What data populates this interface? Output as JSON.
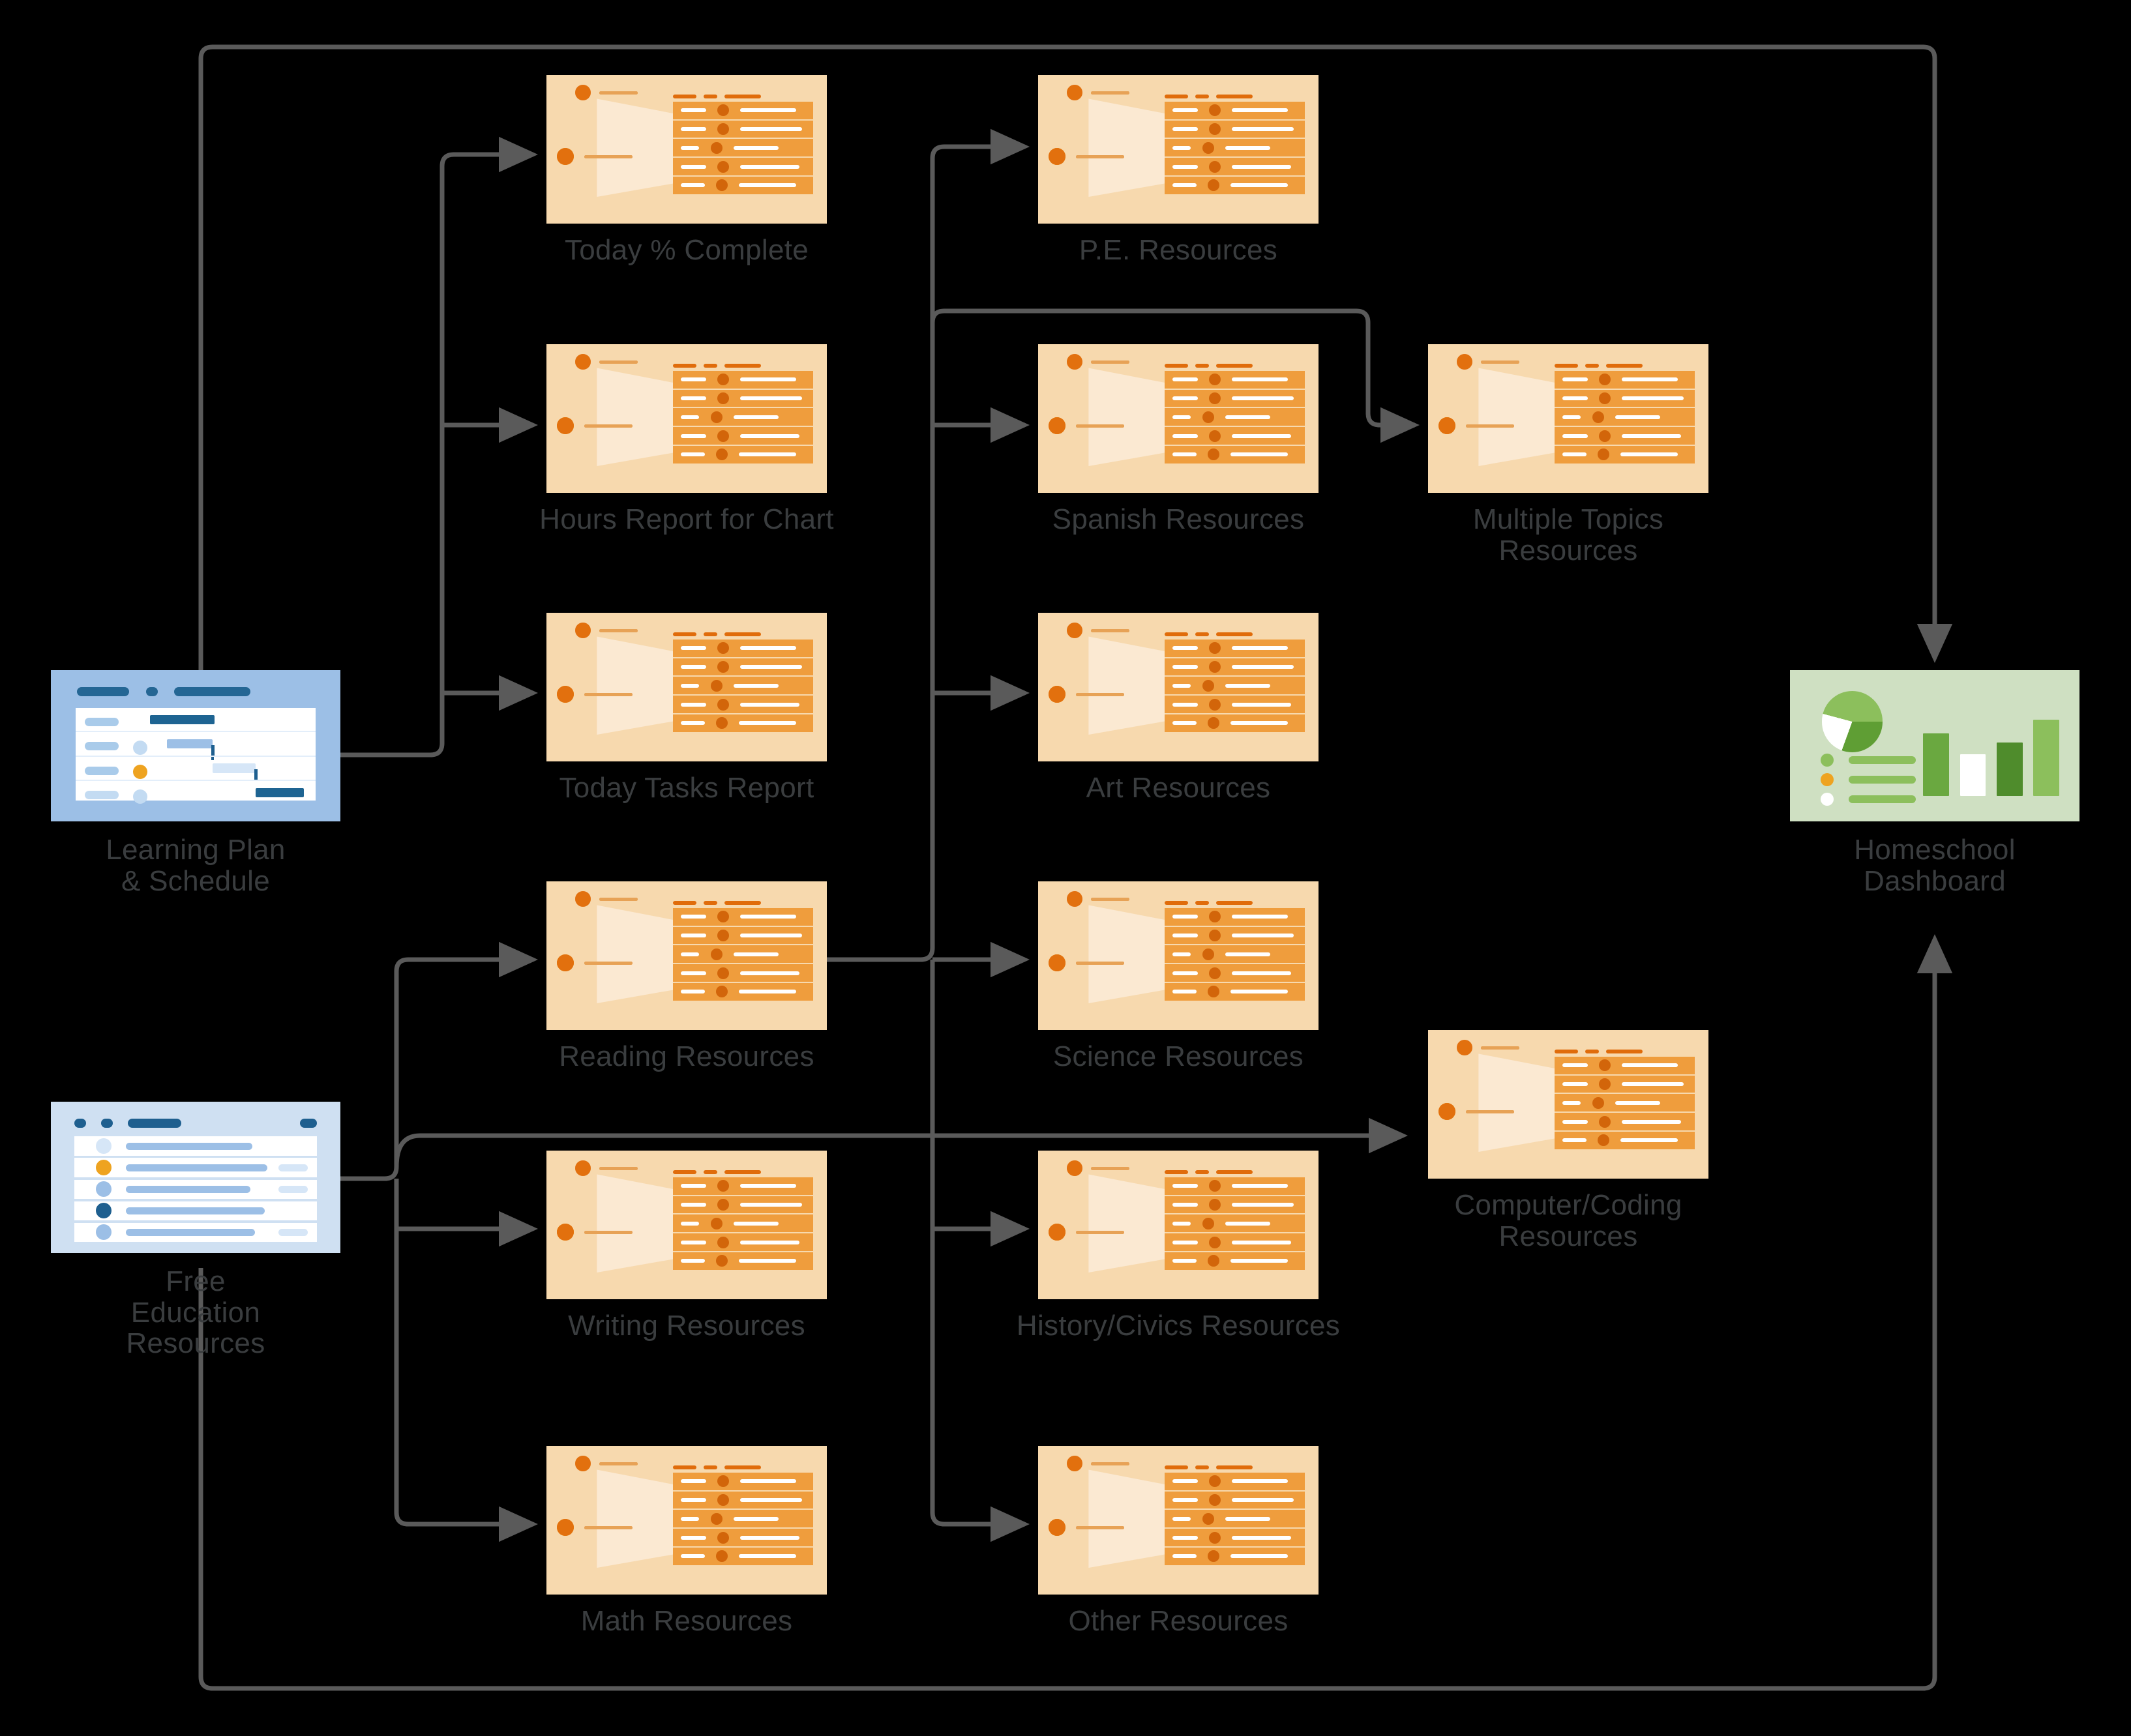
{
  "diagram": {
    "title": "Homeschool Reporting Flow",
    "background_color": "#000000",
    "connector_color": "#5a5a5a",
    "label_color": "#3a3d3f"
  },
  "palette": {
    "report_card_bg": "#f7d9ae",
    "report_table": "#ef9d3d",
    "report_accent": "#e06c0b",
    "gantt_bg": "#9cbfe6",
    "list_bg": "#cfe0f2",
    "blue_accent": "#1e5f8f",
    "amber": "#eea320",
    "dashboard_bg": "#cfe0c2",
    "green_accent": "#5f9e34",
    "green_light": "#8cbf5c"
  },
  "nodes": {
    "sources": [
      {
        "id": "learning-plan",
        "label": "Learning Plan\n& Schedule",
        "icon": "gantt-chart-icon",
        "kind": "gantt"
      },
      {
        "id": "free-education",
        "label": "Free\nEducation\nResources",
        "icon": "list-table-icon",
        "kind": "list"
      }
    ],
    "reports": [
      {
        "id": "today-percent-complete",
        "label": "Today % Complete",
        "icon": "report-icon"
      },
      {
        "id": "hours-report-for-chart",
        "label": "Hours Report for Chart",
        "icon": "report-icon"
      },
      {
        "id": "today-tasks-report",
        "label": "Today Tasks Report",
        "icon": "report-icon"
      },
      {
        "id": "reading-resources",
        "label": "Reading Resources",
        "icon": "report-icon"
      },
      {
        "id": "writing-resources",
        "label": "Writing Resources",
        "icon": "report-icon"
      },
      {
        "id": "math-resources",
        "label": "Math Resources",
        "icon": "report-icon"
      },
      {
        "id": "pe-resources",
        "label": "P.E. Resources",
        "icon": "report-icon"
      },
      {
        "id": "spanish-resources",
        "label": "Spanish Resources",
        "icon": "report-icon"
      },
      {
        "id": "art-resources",
        "label": "Art Resources",
        "icon": "report-icon"
      },
      {
        "id": "science-resources",
        "label": "Science Resources",
        "icon": "report-icon"
      },
      {
        "id": "history-civics-resources",
        "label": "History/Civics Resources",
        "icon": "report-icon"
      },
      {
        "id": "other-resources",
        "label": "Other Resources",
        "icon": "report-icon"
      },
      {
        "id": "multiple-topics-resources",
        "label": "Multiple Topics\nResources",
        "icon": "report-icon"
      },
      {
        "id": "computer-coding-resources",
        "label": "Computer/Coding\nResources",
        "icon": "report-icon"
      }
    ],
    "targets": [
      {
        "id": "homeschool-dashboard",
        "label": "Homeschool\nDashboard",
        "icon": "dashboard-chart-icon",
        "kind": "dashboard"
      }
    ]
  },
  "edges": [
    {
      "from": "learning-plan",
      "to": "today-percent-complete"
    },
    {
      "from": "learning-plan",
      "to": "hours-report-for-chart"
    },
    {
      "from": "learning-plan",
      "to": "today-tasks-report"
    },
    {
      "from": "learning-plan",
      "to": "homeschool-dashboard"
    },
    {
      "from": "free-education",
      "to": "reading-resources"
    },
    {
      "from": "free-education",
      "to": "writing-resources"
    },
    {
      "from": "free-education",
      "to": "math-resources"
    },
    {
      "from": "free-education",
      "to": "computer-coding-resources"
    },
    {
      "from": "free-education",
      "to": "homeschool-dashboard"
    },
    {
      "from": "reading-resources",
      "to": "pe-resources"
    },
    {
      "from": "reading-resources",
      "to": "spanish-resources"
    },
    {
      "from": "reading-resources",
      "to": "art-resources"
    },
    {
      "from": "reading-resources",
      "to": "science-resources"
    },
    {
      "from": "reading-resources",
      "to": "history-civics-resources"
    },
    {
      "from": "reading-resources",
      "to": "other-resources"
    },
    {
      "from": "spanish-resources",
      "to": "multiple-topics-resources"
    }
  ],
  "dashboard_chart": {
    "type": "bar",
    "title": "Homeschool Dashboard",
    "categories": [
      "1",
      "2",
      "3",
      "4"
    ],
    "values": [
      72,
      48,
      62,
      88
    ],
    "colors": [
      "#6aa840",
      "#ffffff",
      "#4f8c2c",
      "#8cbf5c"
    ],
    "pie": {
      "slices": [
        25,
        31,
        24,
        20
      ],
      "colors": [
        "#8cbf5c",
        "#5f9e34",
        "#ffffff",
        "#8cbf5c"
      ]
    },
    "legend": [
      "item-green",
      "item-amber",
      "item-white"
    ],
    "grid": false
  }
}
